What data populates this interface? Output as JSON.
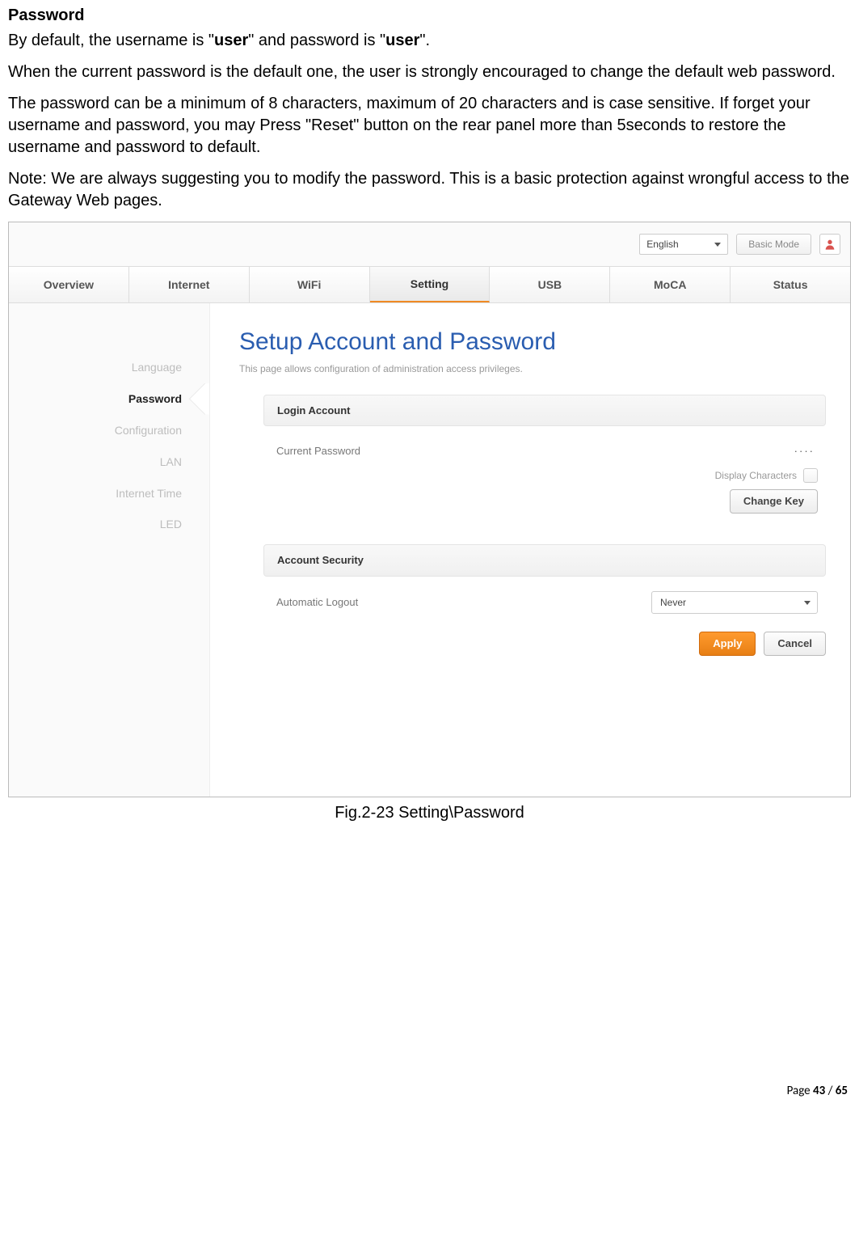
{
  "doc": {
    "heading": "Password",
    "p1a": "By default, the username is \"",
    "p1b": "user",
    "p1c": "\" and password is \"",
    "p1d": "user",
    "p1e": "\".",
    "p2": "When the current password is the default one, the user is strongly encouraged to change the default web password.",
    "p3": "The password can be a minimum of 8 characters, maximum of 20 characters and is case sensitive. If forget your username and password, you may Press \"Reset\" button on the rear panel more than 5seconds to restore the username and password to default.",
    "p4": "Note: We are always suggesting you to modify the password. This is a basic protection against wrongful access to the Gateway Web pages.",
    "caption": "Fig.2-23 Setting\\Password",
    "footer_prefix": "Page ",
    "footer_page": "43",
    "footer_sep": " / ",
    "footer_total": "65"
  },
  "ui": {
    "topbar": {
      "language": "English",
      "mode": "Basic Mode"
    },
    "tabs": [
      "Overview",
      "Internet",
      "WiFi",
      "Setting",
      "USB",
      "MoCA",
      "Status"
    ],
    "active_tab": "Setting",
    "sidebar": [
      "Language",
      "Password",
      "Configuration",
      "LAN",
      "Internet Time",
      "LED"
    ],
    "active_sidebar": "Password",
    "page_title": "Setup Account and Password",
    "page_sub": "This page allows configuration of administration access privileges.",
    "section1_title": "Login Account",
    "current_password_label": "Current Password",
    "current_password_value": "····",
    "display_chars_label": "Display Characters",
    "change_key_label": "Change Key",
    "section2_title": "Account Security",
    "auto_logout_label": "Automatic Logout",
    "auto_logout_value": "Never",
    "apply": "Apply",
    "cancel": "Cancel"
  }
}
